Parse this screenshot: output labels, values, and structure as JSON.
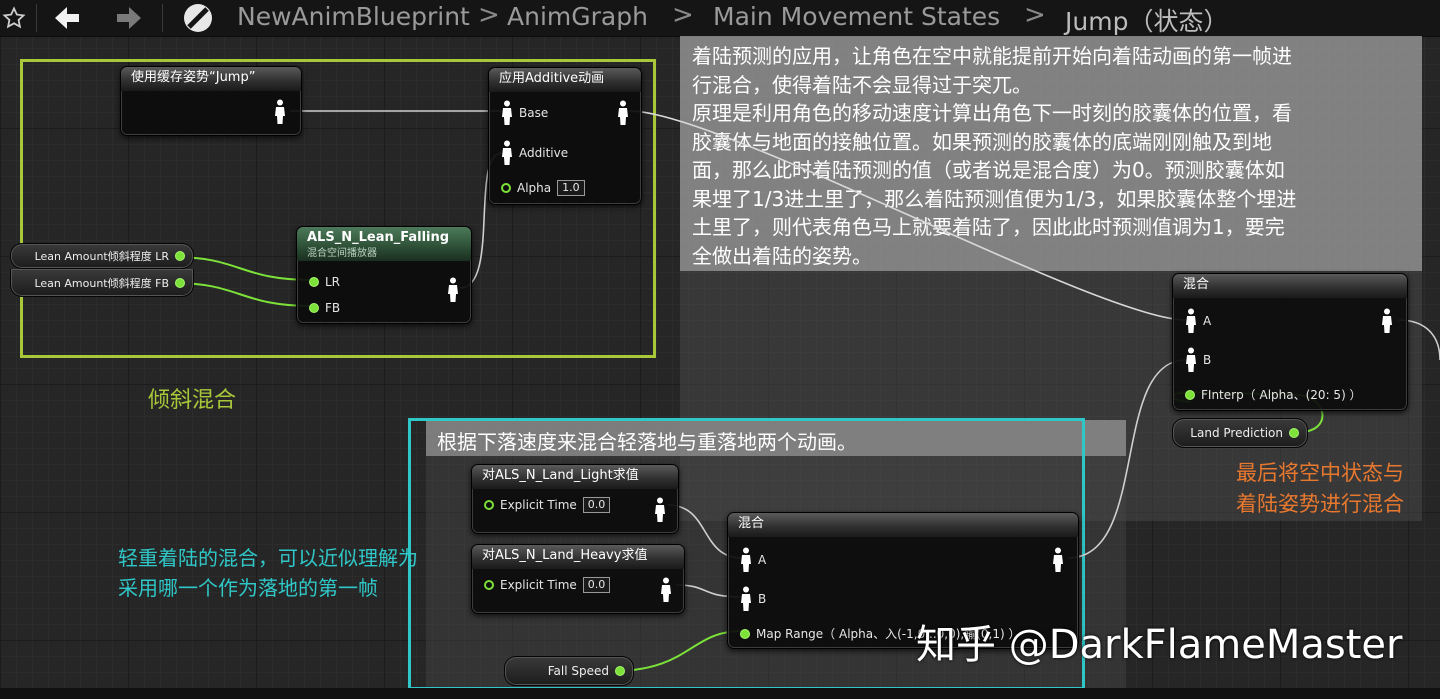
{
  "toolbar": {
    "breadcrumbs": [
      "NewAnimBlueprint",
      "AnimGraph",
      "Main Movement States",
      "Jump（状态）"
    ],
    "separator": ">"
  },
  "comments": {
    "top_right": {
      "lines": [
        "着陆预测的应用，让角色在空中就能提前开始向着陆动画的第一帧进",
        "行混合，使得着陆不会显得过于突兀。",
        "原理是利用角色的移动速度计算出角色下一时刻的胶囊体的位置，看",
        "胶囊体与地面的接触位置。如果预测的胶囊体的底端刚刚触及到地",
        "面，那么此时着陆预测的值（或者说是混合度）为0。预测胶囊体如",
        "果埋了1/3进土里了，那么着陆预测值便为1/3，如果胶囊体整个埋进",
        "土里了，则代表角色马上就要着陆了，因此此时预测值调为1，要完",
        "全做出着陆的姿势。"
      ]
    },
    "bottom": {
      "text": "根据下落速度来混合轻落地与重落地两个动画。"
    }
  },
  "labels": {
    "lean_blend": "倾斜混合",
    "land_blend_note_1": "轻重着陆的混合，可以近似理解为",
    "land_blend_note_2": "采用哪一个作为落地的第一帧",
    "final_note_1": "最后将空中状态与",
    "final_note_2": "着陆姿势进行混合",
    "watermark": "知乎 @DarkFlameMaster"
  },
  "nodes": {
    "cached_pose": {
      "title": "使用缓存姿势“Jump”"
    },
    "apply_additive": {
      "title": "应用Additive动画",
      "pins": {
        "base": "Base",
        "additive": "Additive",
        "alpha": "Alpha",
        "alpha_value": "1.0"
      }
    },
    "lean_falling": {
      "title": "ALS_N_Lean_Falling",
      "subtitle": "混合空间播放器",
      "pins": {
        "lr": "LR",
        "fb": "FB"
      }
    },
    "lean_lr_var": {
      "label": "Lean Amount倾斜程度 LR"
    },
    "lean_fb_var": {
      "label": "Lean Amount倾斜程度 FB"
    },
    "blend_top": {
      "title": "混合",
      "pins": {
        "a": "A",
        "b": "B",
        "alpha": "FInterp（ Alpha、(20: 5) ）"
      }
    },
    "land_prediction": {
      "label": "Land Prediction"
    },
    "land_light": {
      "title": "对ALS_N_Land_Light求值",
      "pins": {
        "explicit_time": "Explicit Time",
        "value": "0.0"
      }
    },
    "land_heavy": {
      "title": "对ALS_N_Land_Heavy求值",
      "pins": {
        "explicit_time": "Explicit Time",
        "value": "0.0"
      }
    },
    "blend_bottom": {
      "title": "混合",
      "pins": {
        "a": "A",
        "b": "B",
        "alpha": "Map Range（ Alpha、入(-1,0...0,0),输(0,1) ）"
      }
    },
    "fall_speed": {
      "label": "Fall Speed"
    }
  },
  "colors": {
    "exec_pin": "#7ce23a",
    "lean_group": "#a8c83a",
    "land_group": "#2fc7c7",
    "final_note": "#e8782e",
    "wire_pose": "#cfcfcf"
  },
  "icons": [
    "star-icon",
    "back-arrow-icon",
    "forward-arrow-icon",
    "blueprint-icon",
    "pose-icon"
  ]
}
